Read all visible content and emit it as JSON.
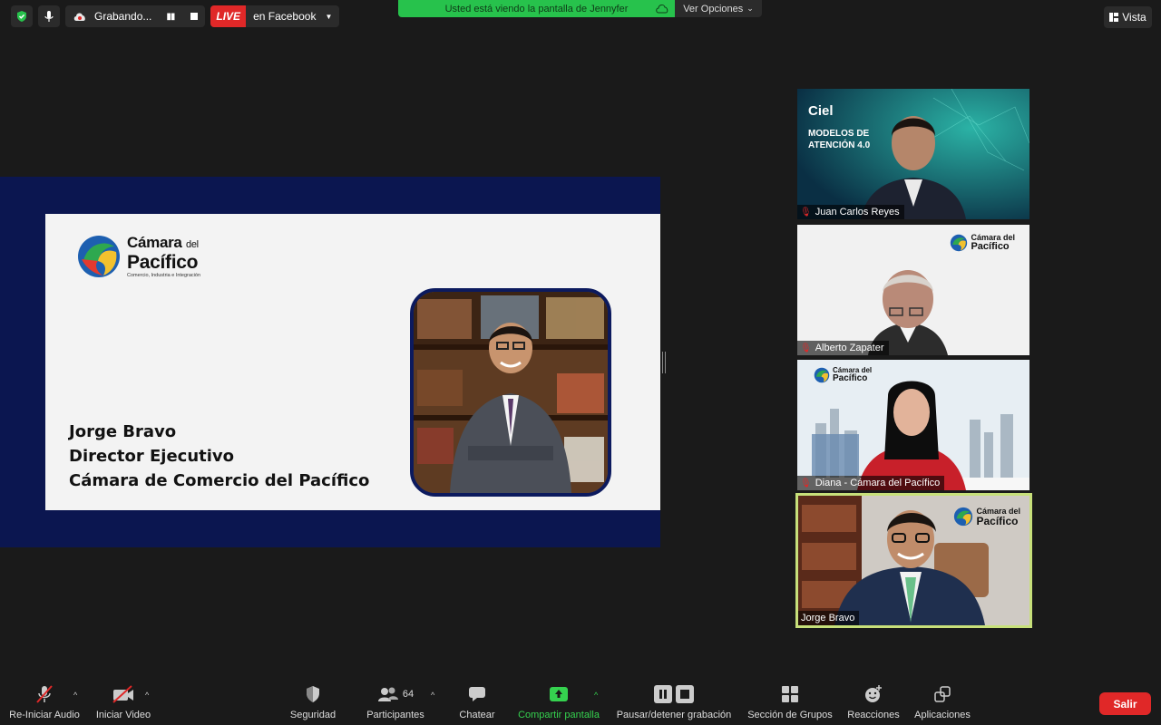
{
  "top": {
    "recording_label": "Grabando...",
    "live_badge": "LIVE",
    "live_target": "en Facebook",
    "share_banner": "Usted está viendo la pantalla de Jennyfer",
    "view_options": "Ver Opciones",
    "view_button": "Vista"
  },
  "slide": {
    "logo_line1": "Cámara",
    "logo_line1_small": "del",
    "logo_line2": "Pacífico",
    "logo_tagline": "Comercio, Industria e Integración",
    "speaker_name": "Jorge Bravo",
    "speaker_role": "Director Ejecutivo",
    "speaker_org": "Cámara de Comercio del Pacífico"
  },
  "tiles": {
    "t1": {
      "name": "Juan Carlos Reyes",
      "brand": "Ciel",
      "bg_text_line1": "MODELOS DE",
      "bg_text_line2": "ATENCIÓN 4.0"
    },
    "t2": {
      "name": "Alberto Zapater",
      "logo_l1": "Cámara del",
      "logo_l2": "Pacífico"
    },
    "t3": {
      "name": "Diana - Cámara del Pacífico",
      "logo_l1": "Cámara del",
      "logo_l2": "Pacífico"
    },
    "t4": {
      "name": "Jorge Bravo",
      "logo_l1": "Cámara del",
      "logo_l2": "Pacífico"
    }
  },
  "toolbar": {
    "audio": "Re-Iniciar Audio",
    "video": "Iniciar Video",
    "security": "Seguridad",
    "participants": "Participantes",
    "participants_count": "64",
    "chat": "Chatear",
    "share": "Compartir pantalla",
    "recording": "Pausar/detener grabación",
    "breakout": "Sección de Grupos",
    "reactions": "Reacciones",
    "apps": "Aplicaciones",
    "leave": "Salir"
  },
  "colors": {
    "accent_green": "#27c24c",
    "live_red": "#e02828",
    "slide_navy": "#0b1650",
    "active_speaker_border": "#c7e07a"
  }
}
